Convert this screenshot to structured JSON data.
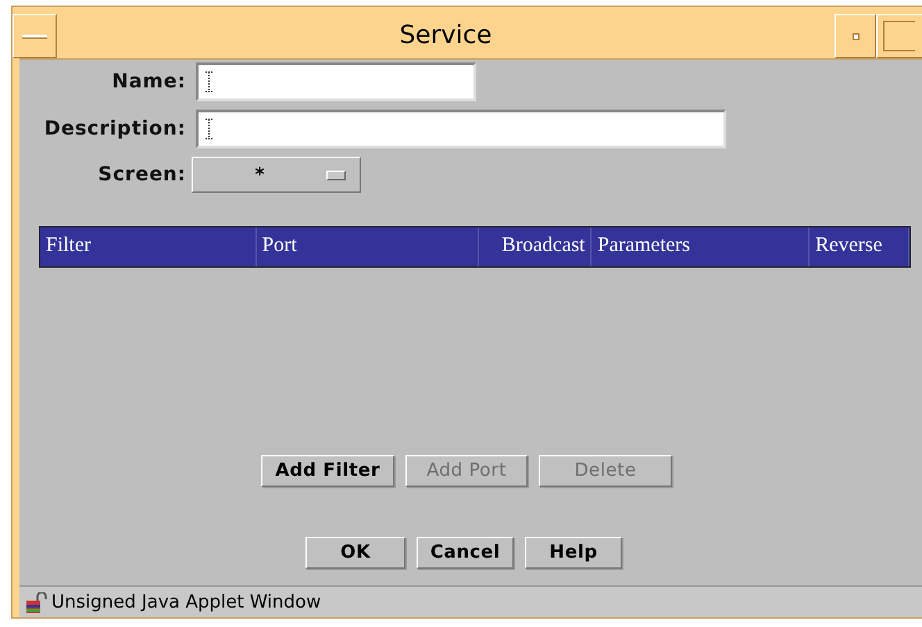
{
  "window": {
    "title": "Service"
  },
  "fields": [
    {
      "kind": "text",
      "label": "Name:"
    },
    {
      "kind": "wide-text",
      "label": "Description:"
    },
    {
      "kind": "choice",
      "label": "Screen:",
      "value": "*"
    }
  ],
  "table": {
    "columns": [
      "Filter",
      "Port",
      "Broadcast",
      "Parameters",
      "Reverse"
    ]
  },
  "table_buttons": [
    {
      "label": "Add Filter",
      "disabled": false
    },
    {
      "label": "Add Port",
      "disabled": true
    },
    {
      "label": "Delete",
      "disabled": true
    }
  ],
  "dialog_buttons": [
    {
      "label": "OK",
      "disabled": false
    },
    {
      "label": "Cancel",
      "disabled": false
    },
    {
      "label": "Help",
      "disabled": false
    }
  ],
  "status_bar": {
    "text": "Unsigned Java Applet Window"
  }
}
